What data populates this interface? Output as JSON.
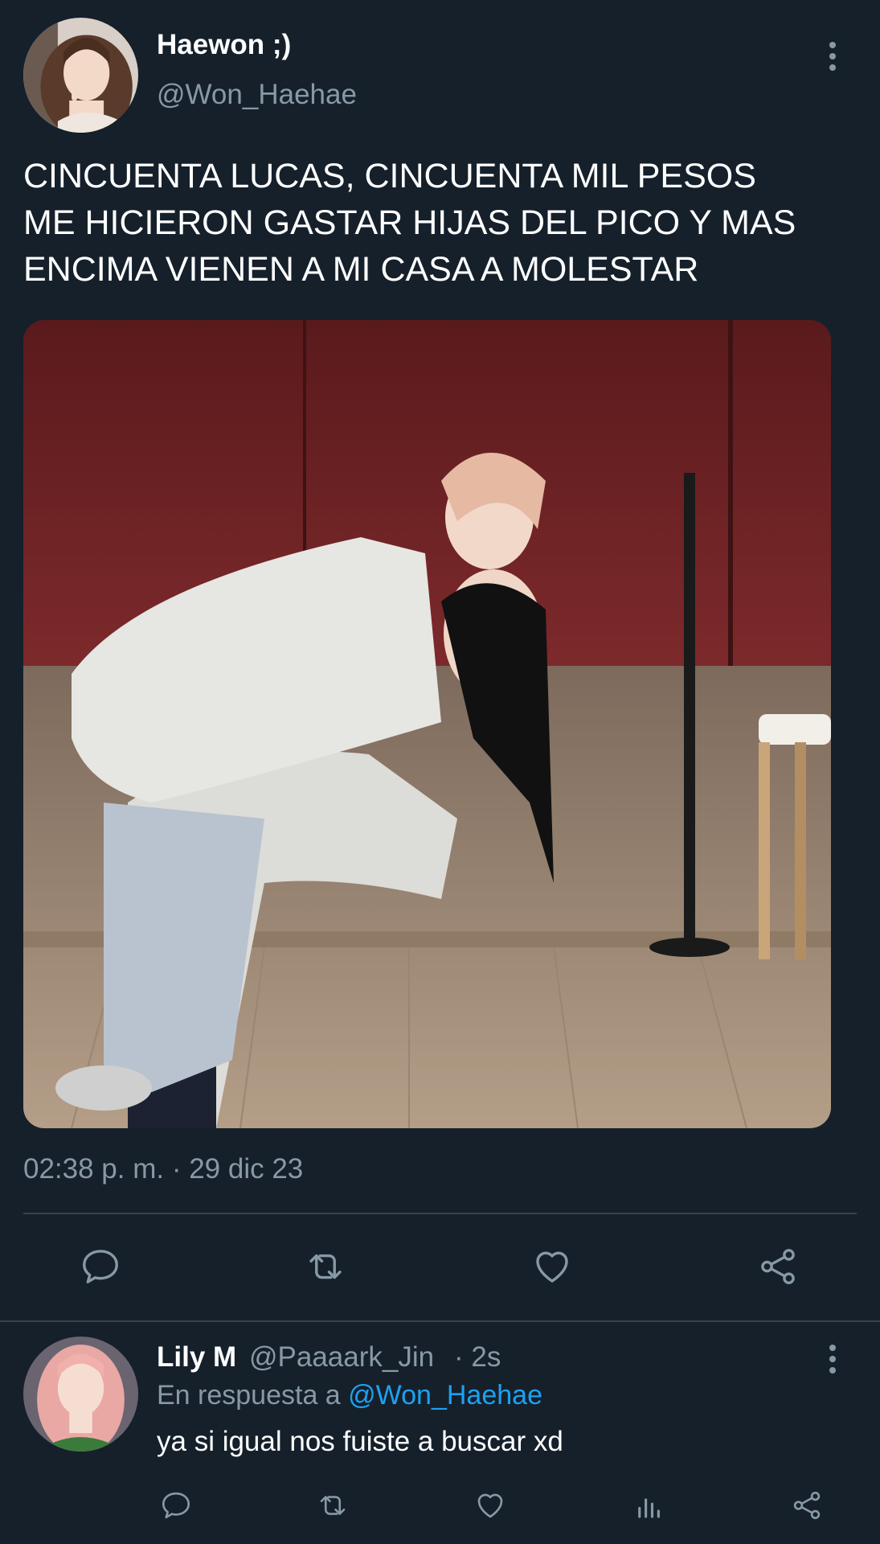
{
  "tweet": {
    "author_name": "Haewon ;)",
    "author_handle": "@Won_Haehae",
    "text": "CINCUENTA LUCAS, CINCUENTA MIL PESOS\nME HICIERON GASTAR HIJAS DEL PICO Y MAS\nENCIMA VIENEN A MI CASA A MOLESTAR",
    "timestamp": "02:38 p. m. · 29 dic 23",
    "actions": [
      "reply-icon",
      "retweet-icon",
      "like-icon",
      "share-icon"
    ]
  },
  "reply": {
    "author_name": "Lily M",
    "author_handle": "@Paaaark_Jin",
    "age": "· 2s",
    "replying_prefix": "En respuesta a",
    "replying_to": "@Won_Haehae",
    "text": "ya si igual nos fuiste a buscar xd",
    "actions": [
      "reply-icon",
      "retweet-icon",
      "like-icon",
      "analytics-icon",
      "share-icon"
    ]
  },
  "colors": {
    "background": "#15202b",
    "secondary_text": "#8899a6",
    "accent": "#1da1f2",
    "divider": "#38444d"
  }
}
